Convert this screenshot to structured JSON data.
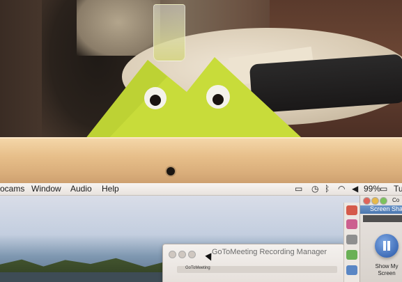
{
  "menubar": {
    "items": [
      "ocams",
      "Window",
      "Audio",
      "Help"
    ],
    "battery": "99%",
    "clock_partial": "Tu"
  },
  "desktop": {
    "window_title": "GoToMeeting Recording Manager",
    "window_subtext": "GoToMeeting"
  },
  "panel": {
    "head_partial": "Co",
    "title": "Screen Sharin",
    "show_label": "Show My Screen"
  },
  "colors": {
    "frog": "#c8dc3a",
    "bezel": "#e7bf8a",
    "play_button": "#3f6db8"
  }
}
